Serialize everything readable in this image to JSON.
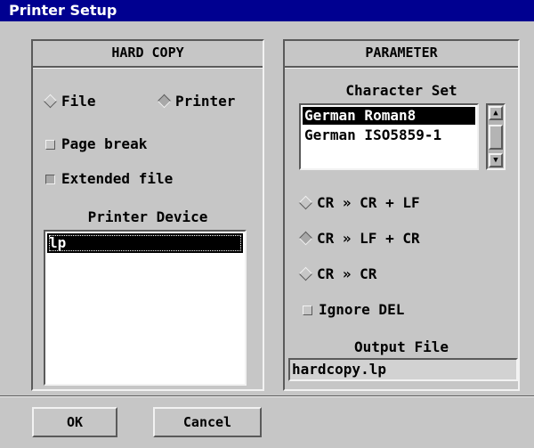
{
  "window": {
    "title": "Printer Setup"
  },
  "hard_copy": {
    "header": "HARD COPY",
    "output_options": [
      {
        "label": "File",
        "selected": false
      },
      {
        "label": "Printer",
        "selected": true
      }
    ],
    "page_break": {
      "label": "Page break",
      "checked": false
    },
    "extended_file": {
      "label": "Extended file",
      "checked": true
    },
    "printer_device_label": "Printer Device",
    "printer_device_value": "lp"
  },
  "parameter": {
    "header": "PARAMETER",
    "character_set_label": "Character Set",
    "character_set_options": [
      "German Roman8",
      "German ISO5859-1"
    ],
    "character_set_selected": "German Roman8",
    "line_endings": [
      {
        "label": "CR » CR + LF",
        "selected": false
      },
      {
        "label": "CR » LF + CR",
        "selected": true
      },
      {
        "label": "CR » CR",
        "selected": false
      }
    ],
    "ignore_del": {
      "label": "Ignore DEL",
      "checked": false
    },
    "output_file_label": "Output File",
    "output_file_value": "hardcopy.lp"
  },
  "buttons": {
    "ok": "OK",
    "cancel": "Cancel"
  }
}
